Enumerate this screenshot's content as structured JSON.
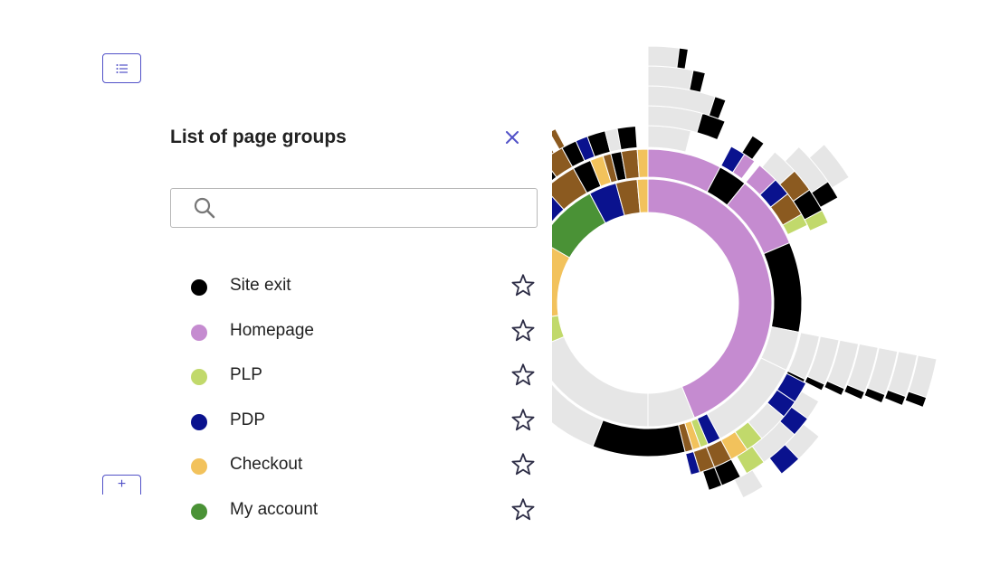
{
  "panel": {
    "title": "List of page groups",
    "search": {
      "value": "",
      "placeholder": ""
    },
    "groups": [
      {
        "label": "Site exit",
        "color": "#000000",
        "icon": "star-outline-icon"
      },
      {
        "label": "Homepage",
        "color": "#c58bd0",
        "icon": "star-outline-icon"
      },
      {
        "label": "PLP",
        "color": "#c1d96b",
        "icon": "star-outline-icon"
      },
      {
        "label": "PDP",
        "color": "#0a128e",
        "icon": "star-outline-icon"
      },
      {
        "label": "Checkout",
        "color": "#f2c25c",
        "icon": "star-outline-icon"
      },
      {
        "label": "My account",
        "color": "#4a9236",
        "icon": "star-outline-icon"
      }
    ]
  },
  "toolbar": {
    "list_icon": "list-icon",
    "add_label": "+",
    "close_icon": "close-icon"
  },
  "colors": {
    "accent": "#5252c8",
    "site_exit": "#000000",
    "homepage": "#c58bd0",
    "plp": "#c1d96b",
    "pdp": "#0a128e",
    "checkout": "#f2c25c",
    "my_account": "#4a9236",
    "other": "#e6e6e6",
    "brown": "#8b5a20"
  }
}
